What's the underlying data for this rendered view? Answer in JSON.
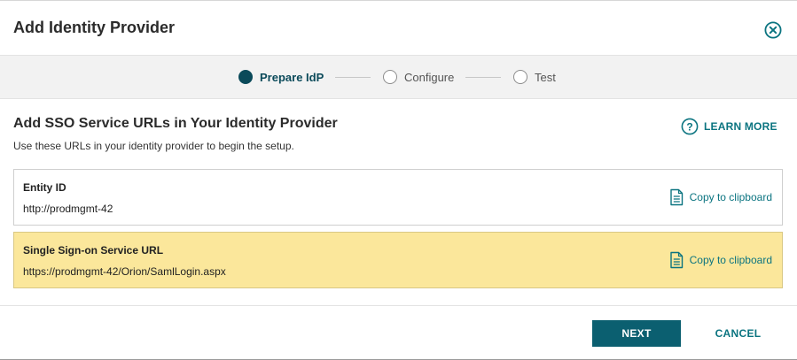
{
  "dialog": {
    "title": "Add Identity Provider",
    "close_icon": "close-circle-icon"
  },
  "stepper": {
    "steps": [
      {
        "label": "Prepare IdP",
        "state": "active"
      },
      {
        "label": "Configure",
        "state": "pending"
      },
      {
        "label": "Test",
        "state": "pending"
      }
    ]
  },
  "section": {
    "title": "Add SSO Service URLs in Your Identity Provider",
    "description": "Use these URLs in your identity provider to begin the setup."
  },
  "learn_more": {
    "label": "LEARN MORE",
    "icon": "question-circle-icon"
  },
  "urls": [
    {
      "label": "Entity ID",
      "value": "http://prodmgmt-42",
      "copy_label": "Copy to clipboard",
      "highlighted": false
    },
    {
      "label": "Single Sign-on Service URL",
      "value": "https://prodmgmt-42/Orion/SamlLogin.aspx",
      "copy_label": "Copy to clipboard",
      "highlighted": true
    }
  ],
  "footer": {
    "next_label": "NEXT",
    "cancel_label": "CANCEL"
  },
  "colors": {
    "accent": "#0b7480",
    "primary_button": "#0b5f70",
    "active_step": "#0b4a5a",
    "highlight": "#fbe79b"
  }
}
